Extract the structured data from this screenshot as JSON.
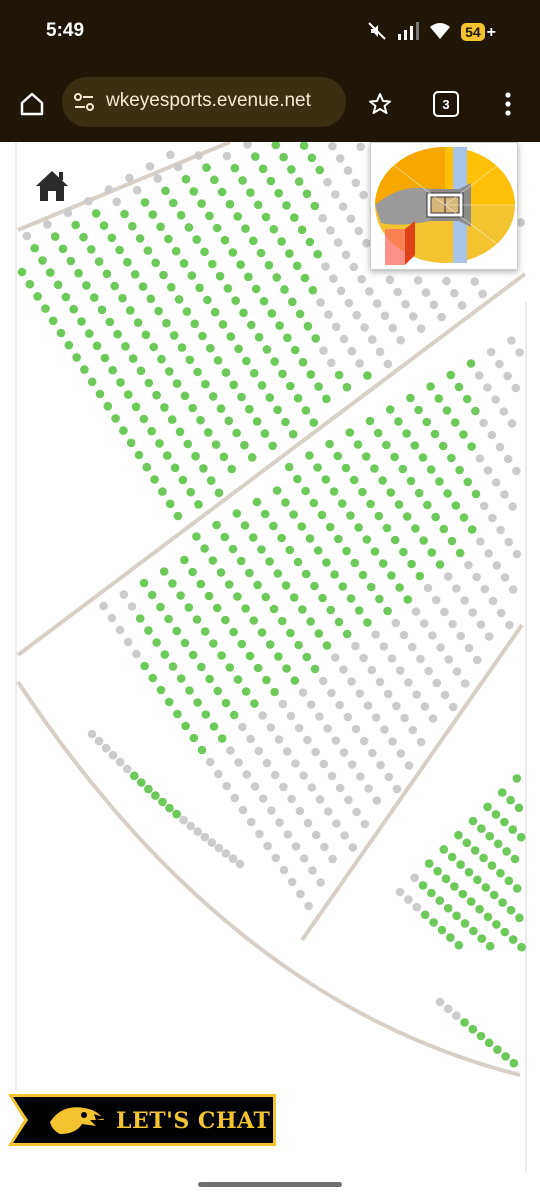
{
  "status_bar": {
    "time": "5:49",
    "battery": "54",
    "icons": [
      "mute-icon",
      "signal-icon",
      "wifi-icon",
      "battery-icon"
    ]
  },
  "browser": {
    "url": "wkeyesports.evenue.net",
    "tab_count": "3",
    "icons": [
      "home-icon",
      "site-settings-icon",
      "bookmark-star-icon",
      "menu-icon"
    ]
  },
  "map": {
    "home_icon": "home-icon",
    "colors": {
      "available_seat": "#6cc95a",
      "unavailable_seat": "#cccccc",
      "aisle_line": "#d8cfc6",
      "minimap_gold": "#f4c430",
      "minimap_blue": "#a9c4e8",
      "minimap_highlight": "#ff6b5e"
    }
  },
  "chat": {
    "label": "LET'S CHAT",
    "logo": "hawkeye-logo",
    "colors": {
      "background": "#000000",
      "accent": "#f4c430"
    }
  }
}
